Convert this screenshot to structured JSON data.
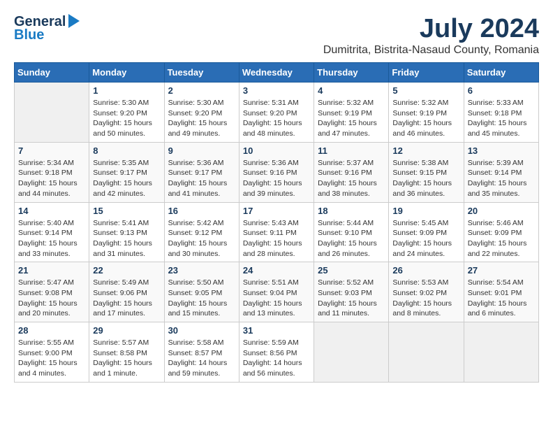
{
  "header": {
    "logo_general": "General",
    "logo_blue": "Blue",
    "month_year": "July 2024",
    "location": "Dumitrita, Bistrita-Nasaud County, Romania"
  },
  "columns": [
    "Sunday",
    "Monday",
    "Tuesday",
    "Wednesday",
    "Thursday",
    "Friday",
    "Saturday"
  ],
  "weeks": [
    [
      {
        "day": "",
        "info": ""
      },
      {
        "day": "1",
        "info": "Sunrise: 5:30 AM\nSunset: 9:20 PM\nDaylight: 15 hours\nand 50 minutes."
      },
      {
        "day": "2",
        "info": "Sunrise: 5:30 AM\nSunset: 9:20 PM\nDaylight: 15 hours\nand 49 minutes."
      },
      {
        "day": "3",
        "info": "Sunrise: 5:31 AM\nSunset: 9:20 PM\nDaylight: 15 hours\nand 48 minutes."
      },
      {
        "day": "4",
        "info": "Sunrise: 5:32 AM\nSunset: 9:19 PM\nDaylight: 15 hours\nand 47 minutes."
      },
      {
        "day": "5",
        "info": "Sunrise: 5:32 AM\nSunset: 9:19 PM\nDaylight: 15 hours\nand 46 minutes."
      },
      {
        "day": "6",
        "info": "Sunrise: 5:33 AM\nSunset: 9:18 PM\nDaylight: 15 hours\nand 45 minutes."
      }
    ],
    [
      {
        "day": "7",
        "info": "Sunrise: 5:34 AM\nSunset: 9:18 PM\nDaylight: 15 hours\nand 44 minutes."
      },
      {
        "day": "8",
        "info": "Sunrise: 5:35 AM\nSunset: 9:17 PM\nDaylight: 15 hours\nand 42 minutes."
      },
      {
        "day": "9",
        "info": "Sunrise: 5:36 AM\nSunset: 9:17 PM\nDaylight: 15 hours\nand 41 minutes."
      },
      {
        "day": "10",
        "info": "Sunrise: 5:36 AM\nSunset: 9:16 PM\nDaylight: 15 hours\nand 39 minutes."
      },
      {
        "day": "11",
        "info": "Sunrise: 5:37 AM\nSunset: 9:16 PM\nDaylight: 15 hours\nand 38 minutes."
      },
      {
        "day": "12",
        "info": "Sunrise: 5:38 AM\nSunset: 9:15 PM\nDaylight: 15 hours\nand 36 minutes."
      },
      {
        "day": "13",
        "info": "Sunrise: 5:39 AM\nSunset: 9:14 PM\nDaylight: 15 hours\nand 35 minutes."
      }
    ],
    [
      {
        "day": "14",
        "info": "Sunrise: 5:40 AM\nSunset: 9:14 PM\nDaylight: 15 hours\nand 33 minutes."
      },
      {
        "day": "15",
        "info": "Sunrise: 5:41 AM\nSunset: 9:13 PM\nDaylight: 15 hours\nand 31 minutes."
      },
      {
        "day": "16",
        "info": "Sunrise: 5:42 AM\nSunset: 9:12 PM\nDaylight: 15 hours\nand 30 minutes."
      },
      {
        "day": "17",
        "info": "Sunrise: 5:43 AM\nSunset: 9:11 PM\nDaylight: 15 hours\nand 28 minutes."
      },
      {
        "day": "18",
        "info": "Sunrise: 5:44 AM\nSunset: 9:10 PM\nDaylight: 15 hours\nand 26 minutes."
      },
      {
        "day": "19",
        "info": "Sunrise: 5:45 AM\nSunset: 9:09 PM\nDaylight: 15 hours\nand 24 minutes."
      },
      {
        "day": "20",
        "info": "Sunrise: 5:46 AM\nSunset: 9:09 PM\nDaylight: 15 hours\nand 22 minutes."
      }
    ],
    [
      {
        "day": "21",
        "info": "Sunrise: 5:47 AM\nSunset: 9:08 PM\nDaylight: 15 hours\nand 20 minutes."
      },
      {
        "day": "22",
        "info": "Sunrise: 5:49 AM\nSunset: 9:06 PM\nDaylight: 15 hours\nand 17 minutes."
      },
      {
        "day": "23",
        "info": "Sunrise: 5:50 AM\nSunset: 9:05 PM\nDaylight: 15 hours\nand 15 minutes."
      },
      {
        "day": "24",
        "info": "Sunrise: 5:51 AM\nSunset: 9:04 PM\nDaylight: 15 hours\nand 13 minutes."
      },
      {
        "day": "25",
        "info": "Sunrise: 5:52 AM\nSunset: 9:03 PM\nDaylight: 15 hours\nand 11 minutes."
      },
      {
        "day": "26",
        "info": "Sunrise: 5:53 AM\nSunset: 9:02 PM\nDaylight: 15 hours\nand 8 minutes."
      },
      {
        "day": "27",
        "info": "Sunrise: 5:54 AM\nSunset: 9:01 PM\nDaylight: 15 hours\nand 6 minutes."
      }
    ],
    [
      {
        "day": "28",
        "info": "Sunrise: 5:55 AM\nSunset: 9:00 PM\nDaylight: 15 hours\nand 4 minutes."
      },
      {
        "day": "29",
        "info": "Sunrise: 5:57 AM\nSunset: 8:58 PM\nDaylight: 15 hours\nand 1 minute."
      },
      {
        "day": "30",
        "info": "Sunrise: 5:58 AM\nSunset: 8:57 PM\nDaylight: 14 hours\nand 59 minutes."
      },
      {
        "day": "31",
        "info": "Sunrise: 5:59 AM\nSunset: 8:56 PM\nDaylight: 14 hours\nand 56 minutes."
      },
      {
        "day": "",
        "info": ""
      },
      {
        "day": "",
        "info": ""
      },
      {
        "day": "",
        "info": ""
      }
    ]
  ]
}
